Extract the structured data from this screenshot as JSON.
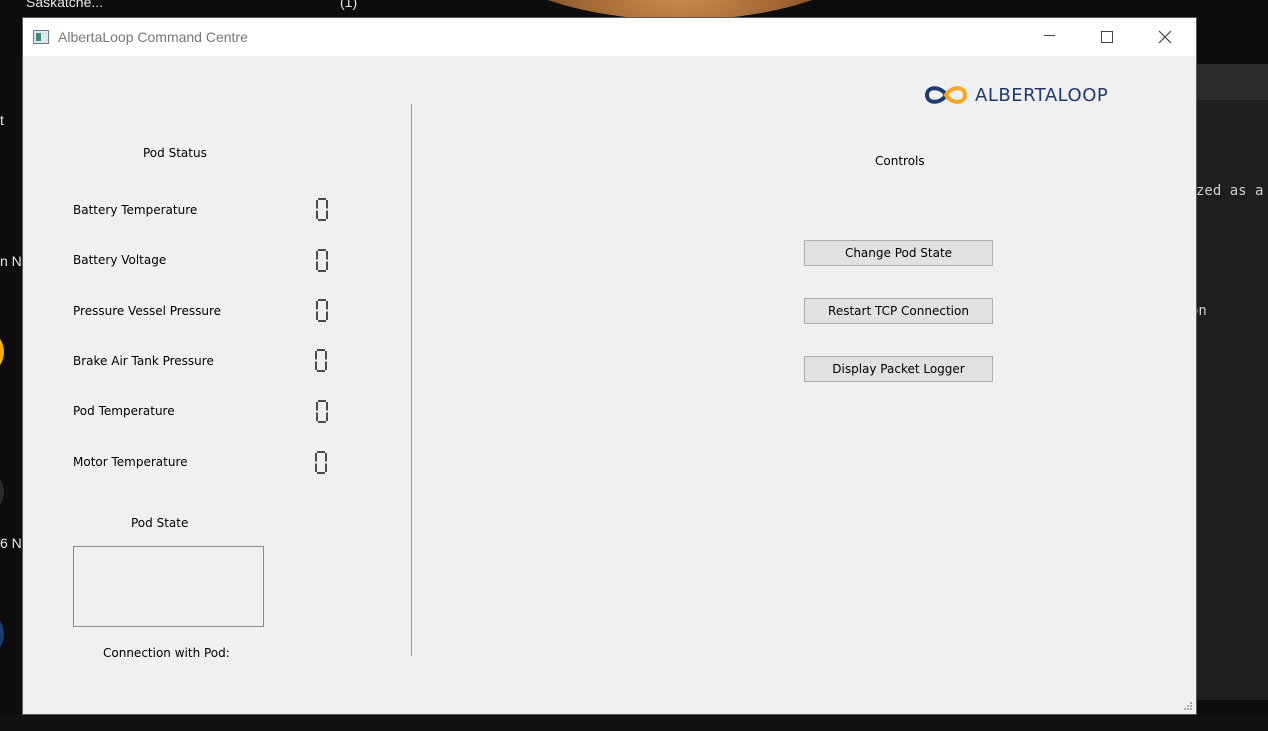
{
  "window": {
    "title": "AlbertaLoop Command Centre"
  },
  "logo": {
    "text": "ALBERTALOOP",
    "colors": {
      "orange": "#f5a623",
      "navy": "#1e3a6e"
    }
  },
  "pod_status": {
    "heading": "Pod Status",
    "rows": [
      {
        "label": "Battery Temperature",
        "value": "0"
      },
      {
        "label": "Battery Voltage",
        "value": "0"
      },
      {
        "label": "Pressure Vessel Pressure",
        "value": "0"
      },
      {
        "label": "Brake Air Tank Pressure",
        "value": "0"
      },
      {
        "label": "Pod Temperature",
        "value": "0"
      },
      {
        "label": "Motor Temperature",
        "value": "0"
      }
    ]
  },
  "pod_state": {
    "heading": "Pod State",
    "connection_label": "Connection with Pod:"
  },
  "controls": {
    "heading": "Controls",
    "buttons": [
      {
        "label": "Change Pod State"
      },
      {
        "label": "Restart TCP Connection"
      },
      {
        "label": "Display Packet Logger"
      }
    ]
  },
  "background": {
    "top_left_text": "Saskatche...",
    "top_count": "(1)",
    "term_line_1": "zed as a",
    "term_line_2": "on",
    "left_frag_1": "t",
    "left_frag_2": "n  N",
    "left_frag_3": "6  N"
  }
}
